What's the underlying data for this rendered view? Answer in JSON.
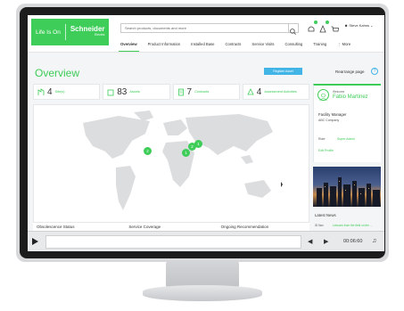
{
  "header": {
    "logo_tagline": "Life Is On",
    "logo_brand": "Schneider",
    "logo_sub": "Electric",
    "search_placeholder": "Search products, documents and more",
    "user_name": "Steve Kahns"
  },
  "nav": {
    "items": [
      "Overview",
      "Product Information",
      "Installed Base",
      "Contracts",
      "Service Visits",
      "Consulting",
      "Training",
      "More"
    ],
    "active": "Overview"
  },
  "page": {
    "title": "Overview",
    "register_button": "Register Asset",
    "rearrange_label": "Rearrange page",
    "help_glyph": "?"
  },
  "stats": [
    {
      "count": "4",
      "label": "Site(s)",
      "icon": "site-icon"
    },
    {
      "count": "83",
      "label": "Assets",
      "icon": "asset-icon"
    },
    {
      "count": "7",
      "label": "Contracts",
      "icon": "contract-icon"
    },
    {
      "count": "4",
      "label": "Assessment Activities",
      "icon": "assessment-icon"
    }
  ],
  "map": {
    "markers": [
      {
        "label": "2"
      },
      {
        "label": "1"
      },
      {
        "label": "2"
      },
      {
        "label": "1"
      }
    ]
  },
  "bottom_tabs": [
    "Obsolescence Status",
    "Service Coverage",
    "Ongoing Recommendation"
  ],
  "profile": {
    "welcome": "Welcome",
    "name": "Fabio Martinez",
    "role": "Facility Manager",
    "company": "ABC Company",
    "role_label": "Role:",
    "role_value": "Super Admin",
    "edit_link": "Edit Profile"
  },
  "news": {
    "heading": "Latest News",
    "id_label": "ID Nov",
    "link_text": "Lessons from the field on the ..."
  },
  "video": {
    "time": "00:06:60",
    "colors": {
      "accent": "#3dcd58",
      "blue": "#42b4e6"
    }
  }
}
